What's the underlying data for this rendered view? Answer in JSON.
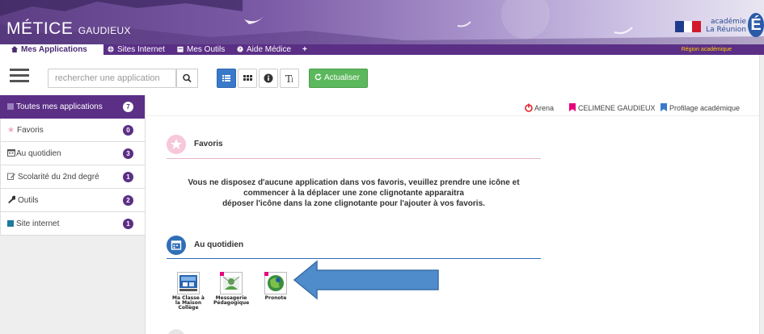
{
  "banner": {
    "brand_main": "MÉTICE",
    "brand_sub": "GAUDIEUX",
    "academie_line1": "académie",
    "academie_line2": "La Réunion",
    "academie_letter": "É",
    "region_label": "Région académique"
  },
  "nav": {
    "tabs": [
      {
        "label": "Mes Applications",
        "icon": "home-icon"
      },
      {
        "label": "Sites Internet",
        "icon": "globe-icon"
      },
      {
        "label": "Mes Outils",
        "icon": "calendar-icon"
      },
      {
        "label": "Aide Médice",
        "icon": "question-icon"
      },
      {
        "label": "+",
        "icon": ""
      }
    ]
  },
  "toolbar": {
    "search_placeholder": "rechercher une application",
    "refresh_label": "Actualiser"
  },
  "sidebar": {
    "items": [
      {
        "label": "Toutes mes applications",
        "count": "7",
        "icon": "square-icon"
      },
      {
        "label": "Favoris",
        "count": "0",
        "icon": "star-icon"
      },
      {
        "label": "Au quotidien",
        "count": "3",
        "icon": "calendar-icon"
      },
      {
        "label": "Scolarité du 2nd degré",
        "count": "1",
        "icon": "edit-icon"
      },
      {
        "label": "Outils",
        "count": "2",
        "icon": "wrench-icon"
      },
      {
        "label": "Site internet",
        "count": "1",
        "icon": "square-icon"
      }
    ]
  },
  "top_links": {
    "arena": "Arena",
    "user": "CELIMENE GAUDIEUX",
    "profile": "Profilage académique"
  },
  "favoris": {
    "title": "Favoris",
    "empty_line1": "Vous ne disposez d'aucune application dans vos favoris, veuillez prendre une icône et",
    "empty_line2": "commencer à la déplacer une zone clignotante apparaitra",
    "empty_line3": "déposer l'icône dans la zone clignotante pour l'ajouter à vos favoris."
  },
  "quotidien": {
    "title": "Au quotidien",
    "apps": [
      {
        "label": "Ma Classe à\nla Maison\nCollège",
        "icon": "classroom-icon"
      },
      {
        "label": "Messagerie\nPédagogique",
        "icon": "messaging-icon"
      },
      {
        "label": "Pronote",
        "icon": "pronote-icon"
      }
    ]
  },
  "colors": {
    "brand_purple": "#5b2f86",
    "accent_blue": "#3a79c9",
    "refresh_green": "#5cb85c",
    "badge_purple": "#5b2f86",
    "annotation_arrow": "#4f8ccb"
  }
}
